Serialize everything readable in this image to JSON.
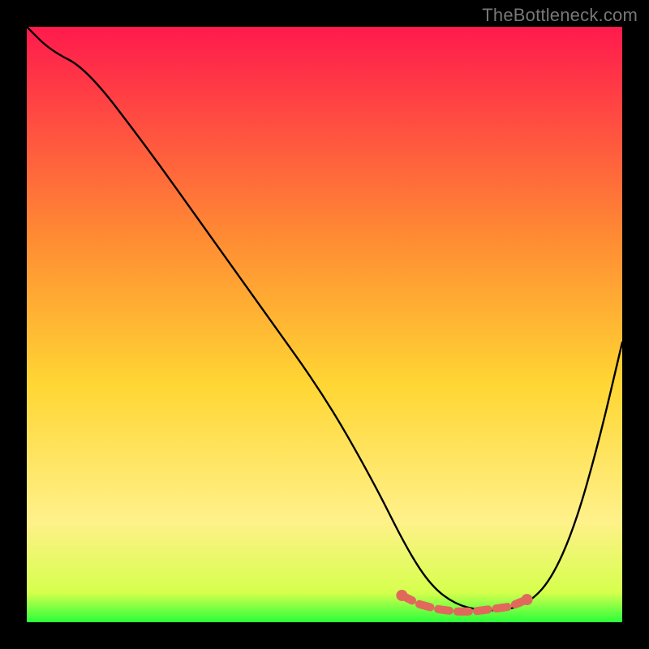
{
  "watermark": "TheBottleneck.com",
  "colors": {
    "page_bg": "#000000",
    "gradient_top": "#ff1a4d",
    "gradient_upper_mid": "#ff8a33",
    "gradient_mid": "#ffd633",
    "gradient_lower_mid": "#fff18a",
    "gradient_bottom": "#2aff3a",
    "curve": "#000000",
    "highlight": "#e0695c"
  },
  "chart_data": {
    "type": "line",
    "title": "",
    "xlabel": "",
    "ylabel": "",
    "xlim": [
      0,
      1
    ],
    "ylim": [
      0,
      1
    ],
    "grid": false,
    "legend": false,
    "series": [
      {
        "name": "curve",
        "x": [
          0.0,
          0.04,
          0.1,
          0.2,
          0.3,
          0.4,
          0.5,
          0.58,
          0.64,
          0.68,
          0.72,
          0.76,
          0.8,
          0.84,
          0.88,
          0.92,
          0.96,
          1.0
        ],
        "y": [
          1.0,
          0.96,
          0.93,
          0.8,
          0.66,
          0.52,
          0.38,
          0.24,
          0.12,
          0.06,
          0.03,
          0.02,
          0.02,
          0.03,
          0.07,
          0.16,
          0.3,
          0.47
        ]
      },
      {
        "name": "highlight",
        "x": [
          0.63,
          0.66,
          0.69,
          0.72,
          0.75,
          0.78,
          0.81,
          0.84
        ],
        "y": [
          0.045,
          0.03,
          0.022,
          0.018,
          0.018,
          0.022,
          0.026,
          0.038
        ]
      }
    ],
    "gradient_stops": [
      {
        "offset": 0.0,
        "color": "#ff1a4d"
      },
      {
        "offset": 0.35,
        "color": "#ff8a33"
      },
      {
        "offset": 0.6,
        "color": "#ffd633"
      },
      {
        "offset": 0.83,
        "color": "#fff18a"
      },
      {
        "offset": 0.95,
        "color": "#d6ff4d"
      },
      {
        "offset": 1.0,
        "color": "#2aff3a"
      }
    ]
  }
}
